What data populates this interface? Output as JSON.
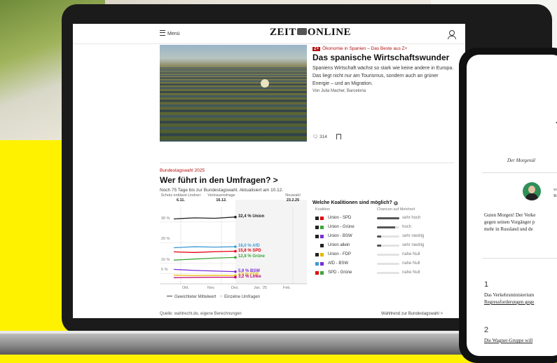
{
  "header": {
    "menu_label": "Menü",
    "logo_left": "ZEIT",
    "logo_right": "ONLINE"
  },
  "article": {
    "kicker_badge": "Z+",
    "kicker": "Ökonomie in Spanien – Das Beste aus Z+",
    "title": "Das spanische Wirtschaftswunder",
    "teaser": "Spaniens Wirtschaft wächst so stark wie keine andere in Europa. Das liegt nicht nur am Tourismus, sondern auch an grüner Energie – und an Migration.",
    "byline": "Von Julia Macher, Barcelona",
    "comment_count": "314"
  },
  "election": {
    "kicker": "Bundestagswahl 2025",
    "title": "Wer führt in den Umfragen?",
    "title_arrow": ">",
    "subtitle": "Noch 75 Tage bis zur Bundestagswahl. Aktualisiert am 10.12.",
    "source": "Quelle: wahlrecht.de, eigene Berechnungen",
    "trend_link": "Wahltrend zur Bundestagswahl",
    "trend_arrow": ">"
  },
  "chart_data": {
    "type": "line",
    "title": "",
    "xlabel": "",
    "ylabel": "",
    "x_ticks": [
      "Okt.",
      "Nov.",
      "Dez.",
      "Jan. '25",
      "Feb."
    ],
    "y_ticks": [
      "30 %",
      "20 %",
      "10 %",
      "5 %"
    ],
    "annotations": [
      {
        "text": "Scholz entlässt Lindner",
        "date": "6.11."
      },
      {
        "text": "Vertrauensfrage",
        "date": "16.12."
      },
      {
        "text": "Neuwahl",
        "date": "23.2.25"
      }
    ],
    "series": [
      {
        "name": "Union",
        "value_label": "32,4 % Union",
        "color": "#222222",
        "values": [
          31.5,
          32.0,
          31.8,
          32.4
        ]
      },
      {
        "name": "AfD",
        "value_label": "18,0 % AfD",
        "color": "#3f9ad6",
        "values": [
          17.5,
          18.0,
          17.8,
          18.0
        ]
      },
      {
        "name": "SPD",
        "value_label": "15,8 % SPD",
        "color": "#e3000f",
        "values": [
          15.5,
          15.2,
          15.6,
          15.8
        ]
      },
      {
        "name": "Grüne",
        "value_label": "12,8 % Grüne",
        "color": "#3aa63a",
        "values": [
          11.5,
          12.0,
          12.5,
          12.8
        ]
      },
      {
        "name": "BSW",
        "value_label": "5,9 % BSW",
        "color": "#7a2fd6",
        "values": [
          7.0,
          6.5,
          6.2,
          5.9
        ]
      },
      {
        "name": "FDP",
        "value_label": "4,0 % FDP",
        "color": "#e6b800",
        "values": [
          4.2,
          4.0,
          4.1,
          4.0
        ]
      },
      {
        "name": "Linke",
        "value_label": "3,2 % Linke",
        "color": "#c0007a",
        "values": [
          3.0,
          3.1,
          3.2,
          3.2
        ]
      }
    ],
    "legend": [
      "Gewichteter Mittelwert",
      "Einzelne Umfragen"
    ]
  },
  "coalitions": {
    "title": "Welche Koalitionen sind möglich?",
    "col_coalition": "Koalition",
    "col_chance": "Chancen auf Mehrheit",
    "rows": [
      {
        "name": "Union - SPD",
        "colors": [
          "#222222",
          "#e3000f"
        ],
        "chance": "sehr hoch",
        "level": 1.0
      },
      {
        "name": "Union - Grüne",
        "colors": [
          "#222222",
          "#3aa63a"
        ],
        "chance": "hoch",
        "level": 0.8
      },
      {
        "name": "Union - BSW",
        "colors": [
          "#222222",
          "#7a2fd6"
        ],
        "chance": "sehr niedrig",
        "level": 0.2
      },
      {
        "name": "Union allein",
        "colors": [
          "#222222"
        ],
        "chance": "sehr niedrig",
        "level": 0.2
      },
      {
        "name": "Union - FDP",
        "colors": [
          "#222222",
          "#e6b800"
        ],
        "chance": "nahe Null",
        "level": 0.0
      },
      {
        "name": "AfD - BSW",
        "colors": [
          "#3f9ad6",
          "#7a2fd6"
        ],
        "chance": "nahe Null",
        "level": 0.0
      },
      {
        "name": "SPD - Grüne",
        "colors": [
          "#e3000f",
          "#3aa63a"
        ],
        "chance": "nahe Null",
        "level": 0.0
      }
    ]
  },
  "phone": {
    "big_letter": "W",
    "subtitle": "Der Morgenül",
    "byline_1": "vo",
    "byline_2": "Re",
    "text": [
      "Guten Morgen! Der Verke",
      "gegen seinen Vorgänger p",
      "mehr in Russland und de"
    ],
    "items": [
      {
        "num": "1",
        "lines": [
          "Das Verkehrsministerium",
          "Regressforderungen gege"
        ]
      },
      {
        "num": "2",
        "lines": [
          "Die Wagner-Gruppe will"
        ]
      }
    ]
  }
}
